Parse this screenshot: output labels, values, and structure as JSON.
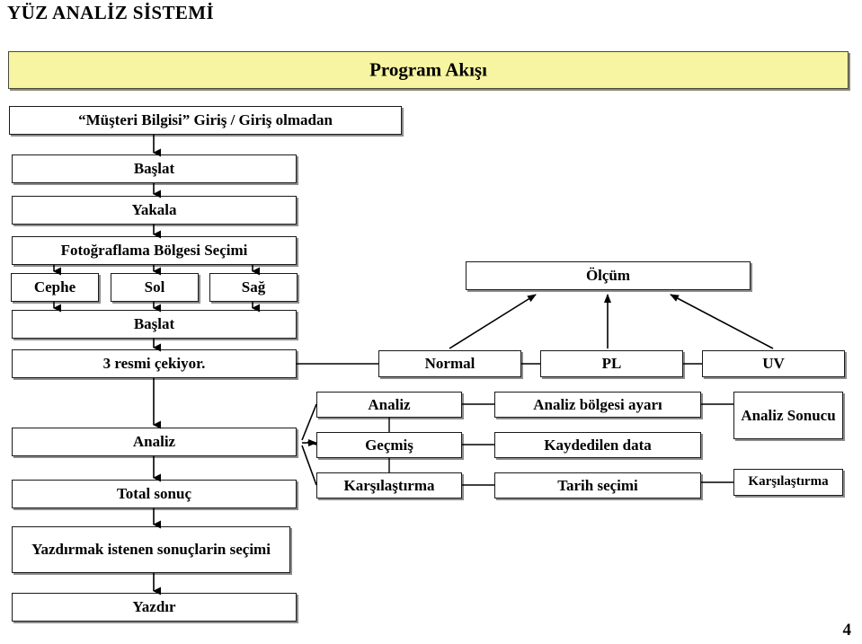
{
  "slide": {
    "title": "YÜZ ANALİZ SİSTEMİ",
    "banner_title": "Program Akışı",
    "page_number": "4"
  },
  "flow": {
    "left_column": [
      {
        "id": "musteri-bilgisi",
        "label": "“Müşteri Bilgisi” Giriş / Giriş olmadan"
      },
      {
        "id": "baslat-1",
        "label": "Başlat"
      },
      {
        "id": "yakala",
        "label": "Yakala"
      },
      {
        "id": "fotograflama-bolgesi-secimi",
        "label": "Fotoğraflama Bölgesi Seçimi"
      },
      {
        "id": "baslat-2",
        "label": "Başlat"
      },
      {
        "id": "3-resmi-cekiyor",
        "label": "3 resmi çekiyor."
      },
      {
        "id": "analiz-left",
        "label": "Analiz"
      },
      {
        "id": "total-sonuc",
        "label": "Total sonuç"
      },
      {
        "id": "yazdirmak-secimi",
        "label": "Yazdırmak istenen sonuçlarin seçimi"
      },
      {
        "id": "yazdir",
        "label": "Yazdır"
      }
    ],
    "angle_row": [
      {
        "id": "cephe",
        "label": "Cephe"
      },
      {
        "id": "sol",
        "label": "Sol"
      },
      {
        "id": "sag",
        "label": "Sağ"
      }
    ],
    "measurement": {
      "id": "olcum",
      "label": "Ölçüm"
    },
    "light_modes": [
      {
        "id": "normal",
        "label": "Normal"
      },
      {
        "id": "pl",
        "label": "PL"
      },
      {
        "id": "uv",
        "label": "UV"
      }
    ],
    "analysis_menu": [
      {
        "id": "analiz",
        "label": "Analiz"
      },
      {
        "id": "gecmis",
        "label": "Geçmiş"
      },
      {
        "id": "karsilastirma",
        "label": "Karşılaştırma"
      }
    ],
    "analysis_actions": [
      {
        "id": "analiz-bolgesi-ayari",
        "label": "Analiz bölgesi ayarı"
      },
      {
        "id": "kaydedilen-data",
        "label": "Kaydedilen data"
      },
      {
        "id": "tarih-secimi",
        "label": "Tarih seçimi"
      }
    ],
    "analysis_results": [
      {
        "id": "analiz-sonucu",
        "label": "Analiz Sonucu"
      },
      {
        "id": "karsilastirma-sonucu",
        "label": "Karşılaştırma"
      }
    ]
  },
  "colors": {
    "banner_fill": "#f7f5a1",
    "banner_border": "#4a4a3c",
    "node_border": "#1a1a1a",
    "node_shadow": "#8c8c8c",
    "text": "#000000",
    "background": "#ffffff"
  }
}
